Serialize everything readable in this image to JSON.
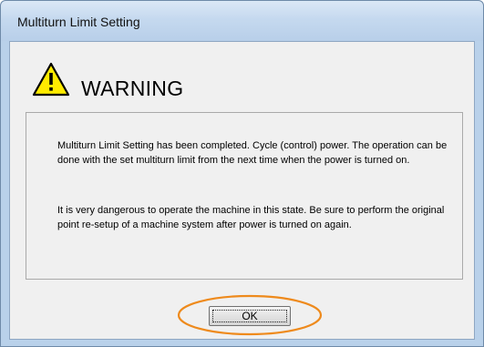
{
  "window": {
    "title": "Multiturn Limit Setting"
  },
  "warning": {
    "icon": "warning-triangle-icon",
    "heading": "WARNING"
  },
  "message": {
    "paragraph1": "Multiturn Limit Setting has been completed. Cycle (control) power. The operation can be done with the set multiturn limit from the next time when the power is turned on.",
    "paragraph2": "It is very dangerous to operate the machine in this state. Be sure to perform the original point re-setup of a machine system after power is turned on again."
  },
  "buttons": {
    "ok_label": "OK"
  },
  "colors": {
    "titlebar": "#c5d9ef",
    "client_background": "#f0f0f0",
    "warning_yellow": "#ffeb00",
    "highlight_orange": "#ee8a1c"
  }
}
